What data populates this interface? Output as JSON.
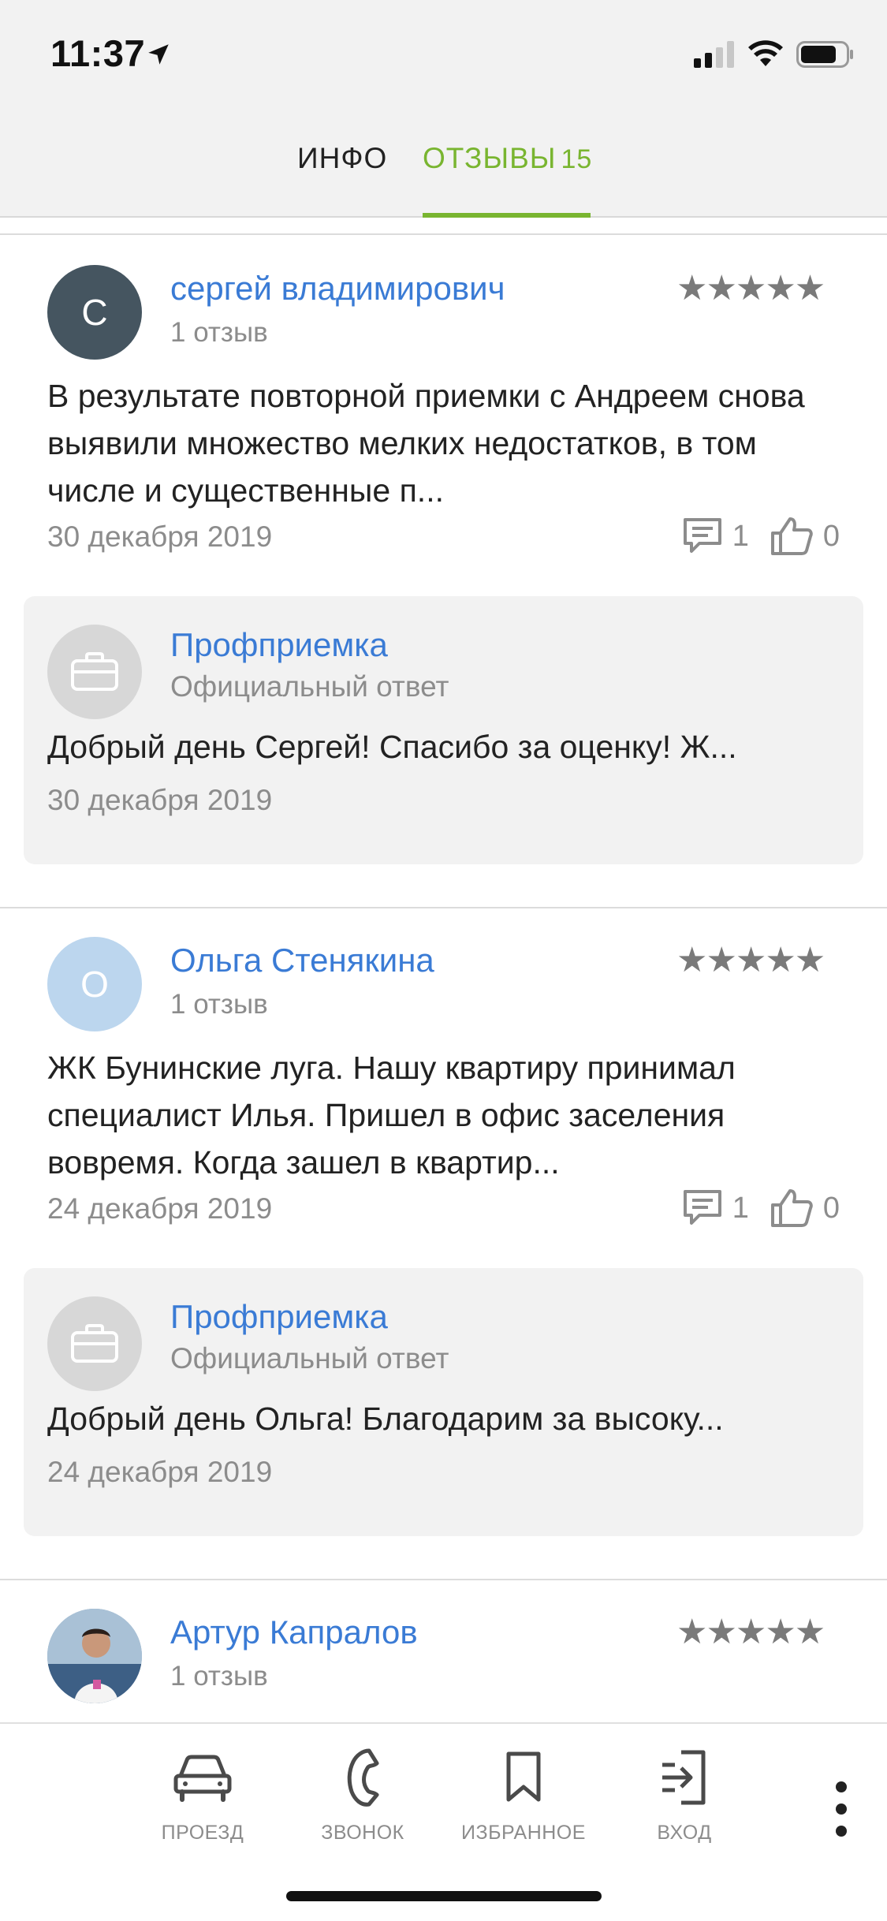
{
  "status_bar": {
    "time": "11:37"
  },
  "tabs": [
    {
      "label": "ИНФО"
    },
    {
      "label": "ОТЗЫВЫ",
      "count": "15"
    }
  ],
  "reviews": [
    {
      "avatar_letter": "С",
      "avatar_color": "#455560",
      "author": "сергей владимирович",
      "reviews_count": "1 отзыв",
      "stars": "★★★★★",
      "text": "В результате повторной приемки с Андреем снова выявили множество мелких недостатков, в том числе и существенные п...",
      "date": "30 декабря 2019",
      "comments": "1",
      "likes": "0",
      "reply": {
        "name": "Профприемка",
        "subtitle": "Официальный ответ",
        "text": "Добрый день Сергей! Спасибо за оценку! Ж...",
        "date": "30 декабря 2019"
      }
    },
    {
      "avatar_letter": "О",
      "avatar_color": "#bcd6ee",
      "author": "Ольга Стенякина",
      "reviews_count": "1 отзыв",
      "stars": "★★★★★",
      "text": "ЖК Бунинские луга. Нашу квартиру принимал специалист Илья. Пришел в офис заселения вовремя. Когда зашел в квартир...",
      "date": "24 декабря 2019",
      "comments": "1",
      "likes": "0",
      "reply": {
        "name": "Профприемка",
        "subtitle": "Официальный ответ",
        "text": "Добрый день Ольга! Благодарим за высоку...",
        "date": "24 декабря 2019"
      }
    },
    {
      "author": "Артур Капралов",
      "reviews_count": "1 отзыв",
      "stars": "★★★★★"
    }
  ],
  "bottom_nav": [
    {
      "label": "ПРОЕЗД",
      "icon": "car-icon"
    },
    {
      "label": "ЗВОНОК",
      "icon": "phone-icon"
    },
    {
      "label": "ИЗБРАННОЕ",
      "icon": "bookmark-icon"
    },
    {
      "label": "ВХОД",
      "icon": "login-icon"
    }
  ],
  "colors": {
    "accent": "#79b530",
    "link": "#3a7bd5",
    "muted": "#8c8c8c"
  }
}
